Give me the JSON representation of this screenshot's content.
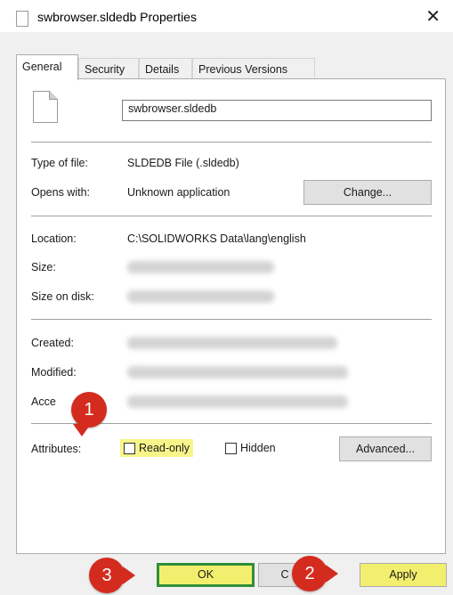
{
  "window": {
    "title": "swbrowser.sldedb Properties",
    "close_glyph": "✕"
  },
  "tabs": [
    {
      "label": "General",
      "active": true
    },
    {
      "label": "Security",
      "active": false
    },
    {
      "label": "Details",
      "active": false
    },
    {
      "label": "Previous Versions",
      "active": false
    }
  ],
  "general": {
    "file_name": "swbrowser.sldedb",
    "type_label": "Type of file:",
    "type_value": "SLDEDB File (.sldedb)",
    "opens_label": "Opens with:",
    "opens_value": "Unknown application",
    "change_button": "Change...",
    "location_label": "Location:",
    "location_value": "C:\\SOLIDWORKS Data\\lang\\english",
    "size_label": "Size:",
    "size_on_disk_label": "Size on disk:",
    "created_label": "Created:",
    "modified_label": "Modified:",
    "accessed_label": "Acce",
    "attributes_label": "Attributes:",
    "readonly_label": "Read-only",
    "hidden_label": "Hidden",
    "advanced_button": "Advanced..."
  },
  "footer": {
    "ok_label": "OK",
    "cancel_label": "C",
    "apply_label": "Apply"
  },
  "markers": {
    "step1": "1",
    "step2": "2",
    "step3": "3"
  },
  "colors": {
    "highlight": "#f3ef6e",
    "marker": "#d42b1f",
    "ok_border": "#2f8f3a"
  }
}
